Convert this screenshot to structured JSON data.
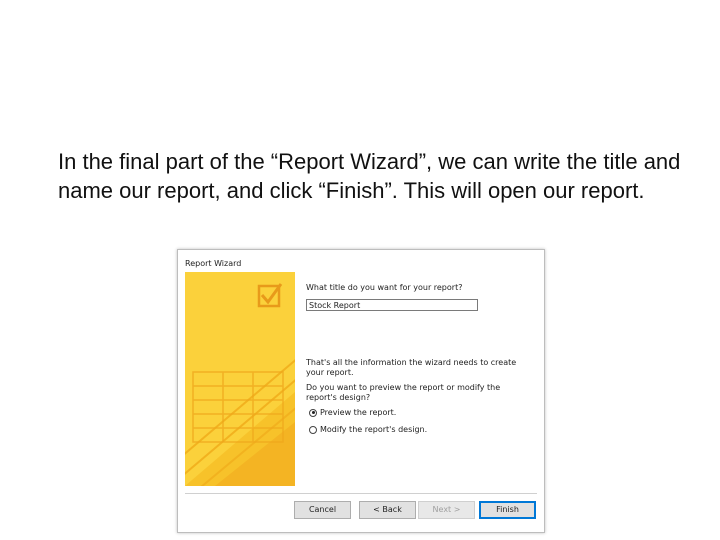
{
  "caption": "In the final part of the “Report Wizard”, we can write the title and name our report, and click “Finish”. This will open our report.",
  "wizard": {
    "title": "Report Wizard",
    "title_question": "What title do you want for your report?",
    "title_value": "Stock Report",
    "info_text": "That's all the information the wizard needs to create your report.",
    "preview_question": "Do you want to preview the report or modify the report's design?",
    "options": [
      {
        "label": "Preview the report.",
        "selected": true
      },
      {
        "label": "Modify the report's design.",
        "selected": false
      }
    ],
    "buttons": {
      "cancel": "Cancel",
      "back": "< Back",
      "next": "Next >",
      "finish": "Finish"
    }
  },
  "colors": {
    "art_yellow": "#fbd13b",
    "art_orange": "#f0a81c",
    "accent": "#0078d7"
  }
}
